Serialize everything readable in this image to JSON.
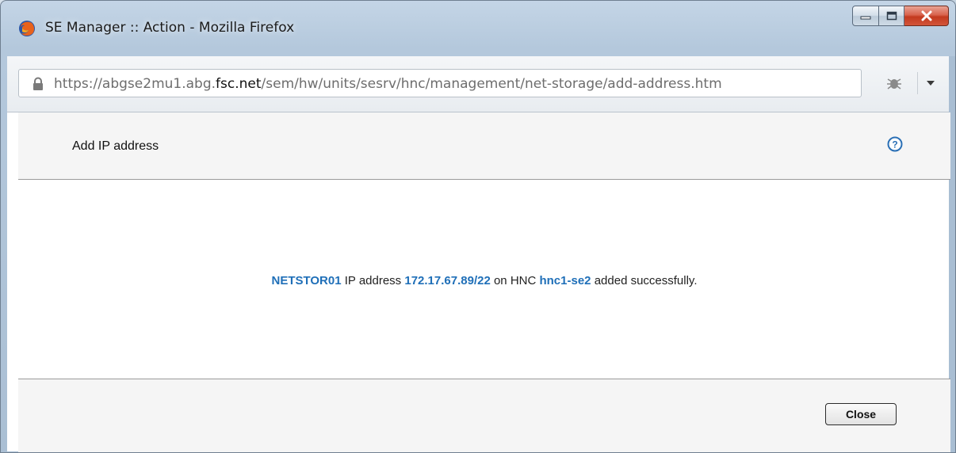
{
  "window": {
    "title": "SE Manager :: Action - Mozilla Firefox",
    "controls": {
      "minimize_icon": "minimize-icon",
      "maximize_icon": "maximize-icon",
      "close_icon": "close-icon"
    }
  },
  "toolbar": {
    "url_scheme": "https://abgse2mu1.abg.",
    "url_host": "fsc.net",
    "url_path": "/sem/hw/units/sesrv/hnc/management/net-storage/add-address.htm",
    "lock_icon": "lock-icon",
    "extension_icon": "bug-icon",
    "menu_icon": "chevron-down-icon"
  },
  "dialog": {
    "title": "Add IP address",
    "help_icon": "help-icon",
    "message": {
      "net_storage": "NETSTOR01",
      "text1": " IP address ",
      "address": "172.17.67.89/22",
      "text2": " on HNC ",
      "hnc": "hnc1-se2",
      "text3": " added successfully."
    },
    "close_label": "Close"
  },
  "colors": {
    "link": "#1f6fb8",
    "panel_bg": "#f5f5f5",
    "titlebar": "#b4c8dc"
  }
}
